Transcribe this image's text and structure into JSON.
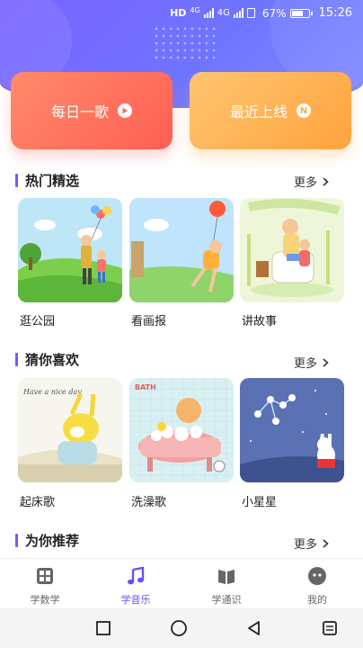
{
  "status_bar": {
    "network": "HD",
    "signal_1": "4G",
    "signal_2": "4G",
    "battery": "67%",
    "time": "15:26"
  },
  "cards": [
    {
      "label": "每日一歌",
      "icon": "play-icon"
    },
    {
      "label": "最近上线",
      "icon": "new-badge-icon",
      "badge": "N"
    }
  ],
  "sections": {
    "hot": {
      "title": "热门精选",
      "more": "更多",
      "items": [
        {
          "label": "逛公园"
        },
        {
          "label": "看画报"
        },
        {
          "label": "讲故事"
        }
      ]
    },
    "guess": {
      "title": "猜你喜欢",
      "more": "更多",
      "items": [
        {
          "label": "起床歌"
        },
        {
          "label": "洗澡歌"
        },
        {
          "label": "小星星"
        }
      ]
    },
    "recommend": {
      "title": "为你推荐",
      "more": "更多"
    }
  },
  "artwork_text": {
    "wake_up": "Have a nice day",
    "bath": "BATH"
  },
  "bottom_nav": [
    {
      "label": "学数学",
      "icon": "calculator-icon"
    },
    {
      "label": "学音乐",
      "icon": "music-note-icon",
      "active": true
    },
    {
      "label": "学通识",
      "icon": "book-icon"
    },
    {
      "label": "我的",
      "icon": "profile-face-icon"
    }
  ],
  "colors": {
    "header": "#7067ff",
    "accent": "#6b4dff",
    "card_song": "#ff6a58",
    "card_new": "#ffab45"
  }
}
